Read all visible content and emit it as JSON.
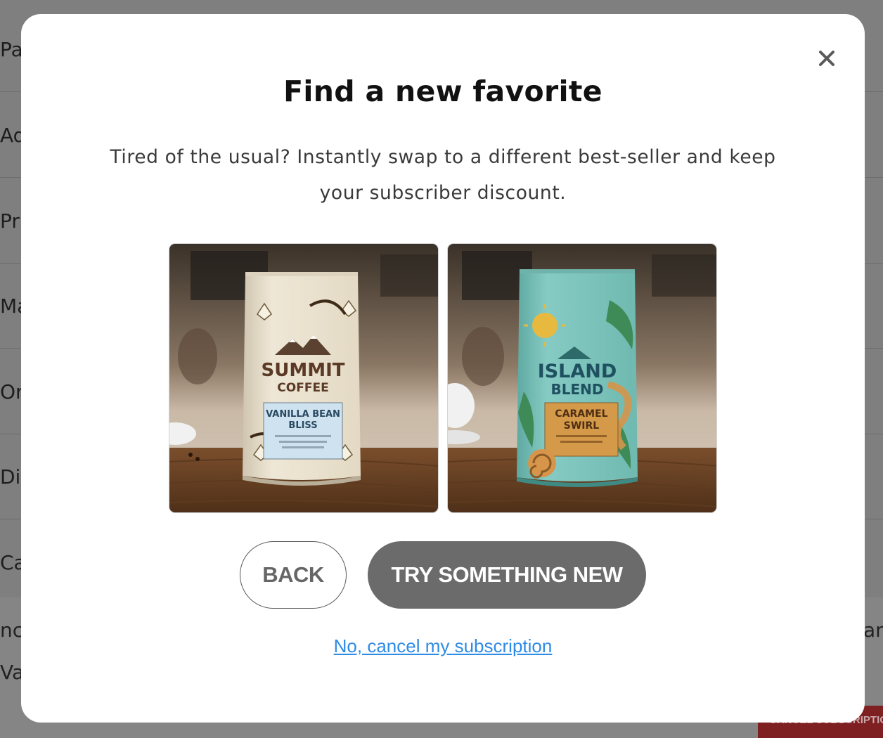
{
  "background": {
    "rows": [
      {
        "label": "Pa"
      },
      {
        "label": "Ad"
      },
      {
        "label": "Pr"
      },
      {
        "label": "Ma"
      },
      {
        "label": "Or"
      },
      {
        "label": "Di"
      },
      {
        "label": "Ca"
      }
    ],
    "bottom_left_lines": [
      "nce",
      "Van"
    ],
    "bottom_right_text": "an",
    "cancel_button_label": "CANCEL SUBSCRIPTIO"
  },
  "modal": {
    "title": "Find a new favorite",
    "description": "Tired of the usual? Instantly swap to a different best-seller and keep your subscriber discount.",
    "close_icon": "close-icon",
    "products": [
      {
        "brand_line1": "SUMMIT",
        "brand_line2": "COFFEE",
        "flavor_line1": "VANILLA BEAN",
        "flavor_line2": "BLISS",
        "bag_color": "#ece3cf",
        "accent_color": "#cfe2ef"
      },
      {
        "brand_line1": "ISLAND",
        "brand_line2": "BLEND",
        "flavor_line1": "CARAMEL",
        "flavor_line2": "SWIRL",
        "bag_color": "#7cc4bd",
        "accent_color": "#d49a4a"
      }
    ],
    "back_label": "BACK",
    "primary_label": "TRY SOMETHING NEW",
    "cancel_link": "No, cancel my subscription"
  },
  "colors": {
    "overlay": "#7f7f7f",
    "primary_button": "#6b6b6b",
    "link": "#2e8be6",
    "cancel_button_bg": "#7e1f22"
  }
}
